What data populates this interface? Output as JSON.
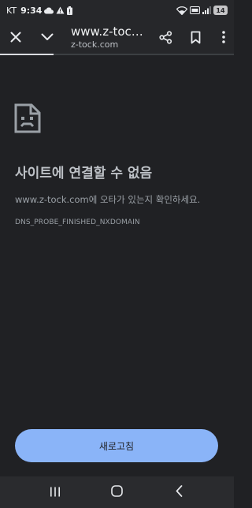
{
  "status_bar": {
    "carrier": "KT",
    "time": "9:34",
    "battery_level": "14"
  },
  "toolbar": {
    "url_title": "www.z-tock...",
    "url_domain": "z-tock.com"
  },
  "error": {
    "title": "사이트에 연결할 수 없음",
    "description": "www.z-tock.com에 오타가 있는지 확인하세요.",
    "code": "DNS_PROBE_FINISHED_NXDOMAIN"
  },
  "reload_button": {
    "label": "새로고침"
  },
  "colors": {
    "background": "#202124",
    "accent": "#8ab4f8",
    "text_muted": "#9aa0a6"
  }
}
